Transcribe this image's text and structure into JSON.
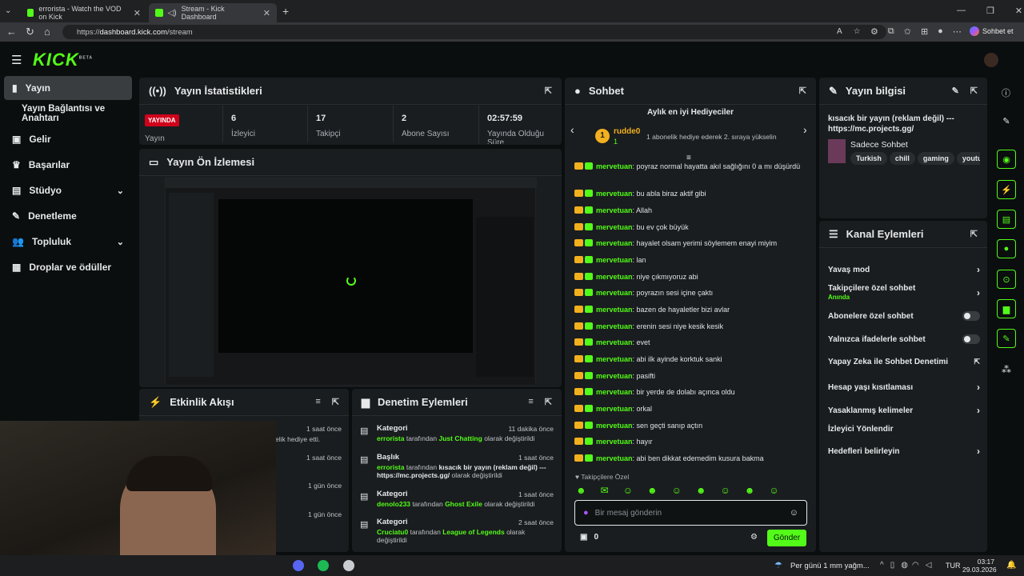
{
  "browser": {
    "tabs": [
      {
        "title": "errorista - Watch the VOD on Kick"
      },
      {
        "title": "Stream - Kick Dashboard"
      }
    ],
    "url_prefix": "https://",
    "url_host": "dashboard.kick.com",
    "url_path": "/stream",
    "sohbet_label": "Sohbet et"
  },
  "site": {
    "logo": "KICK",
    "logo_badge": "BETA"
  },
  "sidebar": {
    "items": [
      {
        "label": "Yayın"
      },
      {
        "label": "Yayın Bağlantısı ve Anahtarı"
      },
      {
        "label": "Gelir"
      },
      {
        "label": "Başarılar"
      },
      {
        "label": "Stüdyo"
      },
      {
        "label": "Denetleme"
      },
      {
        "label": "Topluluk"
      },
      {
        "label": "Droplar ve ödüller"
      }
    ]
  },
  "stats": {
    "title": "Yayın İstatistikleri",
    "live_badge": "YAYINDA",
    "live_label": "Yayın",
    "items": [
      {
        "value": "6",
        "label": "İzleyici"
      },
      {
        "value": "17",
        "label": "Takipçi"
      },
      {
        "value": "2",
        "label": "Abone Sayısı"
      },
      {
        "value": "02:57:59",
        "label": "Yayında Olduğu Süre"
      }
    ]
  },
  "preview": {
    "title": "Yayın Ön İzlemesi"
  },
  "activity": {
    "title": "Etkinlik Akışı",
    "rows": [
      {
        "time": "1 saat önce",
        "text": "elik hediye etti."
      },
      {
        "time": "1 saat önce",
        "text": ""
      },
      {
        "time": "1 gün önce",
        "text": ""
      },
      {
        "time": "1 gün önce",
        "text": ""
      }
    ]
  },
  "moderation": {
    "title": "Denetim Eylemleri",
    "rows": [
      {
        "type": "Kategori",
        "time": "11 dakika önce",
        "user": "errorista",
        "mid": " tarafından ",
        "value": "Just Chatting",
        "end": " olarak değiştirildi"
      },
      {
        "type": "Başlık",
        "time": "1 saat önce",
        "user": "errorista",
        "mid": " tarafından ",
        "value": "kısacık bir yayın (reklam değil) --- https://mc.projects.gg/",
        "end": " olarak değiştirildi"
      },
      {
        "type": "Kategori",
        "time": "1 saat önce",
        "user": "denolo233",
        "mid": " tarafından ",
        "value": "Ghost Exile",
        "end": " olarak değiştirildi"
      },
      {
        "type": "Kategori",
        "time": "2 saat önce",
        "user": "Cruciatu0",
        "mid": " tarafından ",
        "value": "League of Legends",
        "end": " olarak değiştirildi"
      }
    ]
  },
  "chat": {
    "title": "Sohbet",
    "gifters_title": "Aylık en iyi Hediyeciler",
    "gifter_rank": "1",
    "gifter_name": "rudde0",
    "gifter_count": "1",
    "gifter_note": "1 abonelik hediye ederek 2. sıraya yükselin",
    "messages": [
      {
        "user": "mervetuan",
        "text": "poyraz normal hayatta akıl sağlığını 0 a mı düşürdü"
      },
      {
        "user": "mervetuan",
        "text": "bu abla biraz aktif gibi"
      },
      {
        "user": "mervetuan",
        "text": "Allah"
      },
      {
        "user": "mervetuan",
        "text": "bu ev çok büyük"
      },
      {
        "user": "mervetuan",
        "text": "hayalet olsam yerimi söylemem enayi miyim"
      },
      {
        "user": "mervetuan",
        "text": "lan"
      },
      {
        "user": "mervetuan",
        "text": "niye çıkmıyoruz abi"
      },
      {
        "user": "mervetuan",
        "text": "poyrazın sesi içine çaktı"
      },
      {
        "user": "mervetuan",
        "text": "bazen de hayaletler bizi avlar"
      },
      {
        "user": "mervetuan",
        "text": "erenin sesi niye kesik kesik"
      },
      {
        "user": "mervetuan",
        "text": "evet"
      },
      {
        "user": "mervetuan",
        "text": "abi ilk ayinde korktuk sanki"
      },
      {
        "user": "mervetuan",
        "text": "pasifti"
      },
      {
        "user": "mervetuan",
        "text": "bir yerde de dolabı açınca oldu"
      },
      {
        "user": "mervetuan",
        "text": "orkal"
      },
      {
        "user": "mervetuan",
        "text": "sen geçti sanıp açtın"
      },
      {
        "user": "mervetuan",
        "text": "hayır"
      },
      {
        "user": "mervetuan",
        "text": "abi ben dikkat edemedim kusura bakma"
      }
    ],
    "followers_only": "Takipçilere Özel",
    "input_placeholder": "Bir mesaj gönderin",
    "points": "0",
    "send": "Gönder"
  },
  "stream_info": {
    "title": "Yayın bilgisi",
    "stream_title": "kısacık bir yayın (reklam değil) --- https://mc.projects.gg/",
    "category": "Sadece Sohbet",
    "tags": [
      "Turkish",
      "chill",
      "gaming",
      "youtu"
    ]
  },
  "channel_actions": {
    "title": "Kanal Eylemleri",
    "items": [
      {
        "label": "Yavaş mod",
        "sub": ""
      },
      {
        "label": "Takipçilere özel sohbet",
        "sub": "Anında"
      },
      {
        "label": "Abonelere özel sohbet",
        "sub": ""
      },
      {
        "label": "Yalnızca ifadelerle sohbet",
        "sub": ""
      },
      {
        "label": "Yapay Zeka ile Sohbet Denetimi",
        "sub": ""
      },
      {
        "label": "Hesap yaşı kısıtlaması",
        "sub": ""
      },
      {
        "label": "Yasaklanmış kelimeler",
        "sub": ""
      },
      {
        "label": "İzleyici Yönlendir",
        "sub": ""
      },
      {
        "label": "Hedefleri belirleyin",
        "sub": ""
      }
    ]
  },
  "taskbar": {
    "weather": "Per günü 1 mm yağm...",
    "lang": "TUR",
    "time": "03:17",
    "date": "29.03.2026"
  }
}
